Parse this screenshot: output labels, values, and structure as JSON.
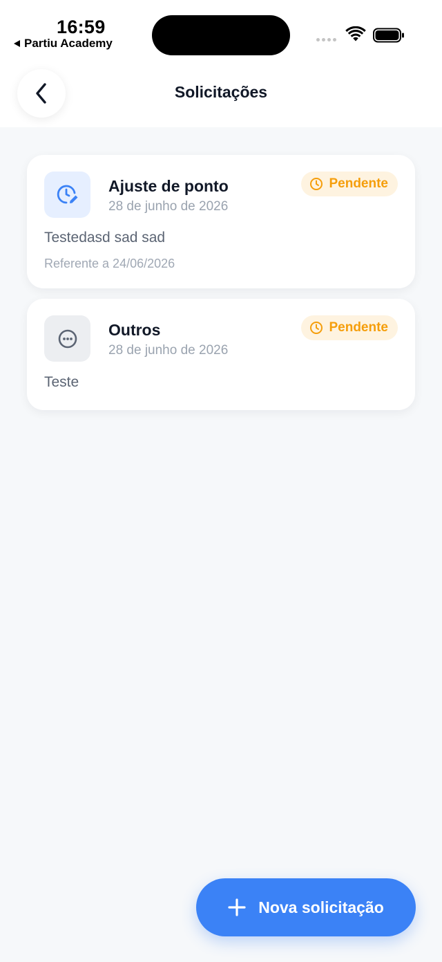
{
  "status_bar": {
    "time": "16:59",
    "back_app": "Partiu Academy"
  },
  "header": {
    "title": "Solicitações",
    "back_icon": "chevron-left-icon"
  },
  "requests": [
    {
      "icon": "clock-edit-icon",
      "icon_color": "#3b82f6",
      "title": "Ajuste de ponto",
      "date": "28 de junho de 2026",
      "status": "Pendente",
      "description": "Testedasd sad sad",
      "reference": "Referente a 24/06/2026"
    },
    {
      "icon": "more-horizontal-circle-icon",
      "icon_color": "#5b6473",
      "title": "Outros",
      "date": "28 de junho de 2026",
      "status": "Pendente",
      "description": "Teste"
    }
  ],
  "fab": {
    "label": "Nova solicitação",
    "icon": "plus-icon"
  },
  "colors": {
    "accent": "#3b82f6",
    "pending": "#f59e0b",
    "pending_bg": "#fef3e0",
    "background": "#f6f8fa"
  }
}
